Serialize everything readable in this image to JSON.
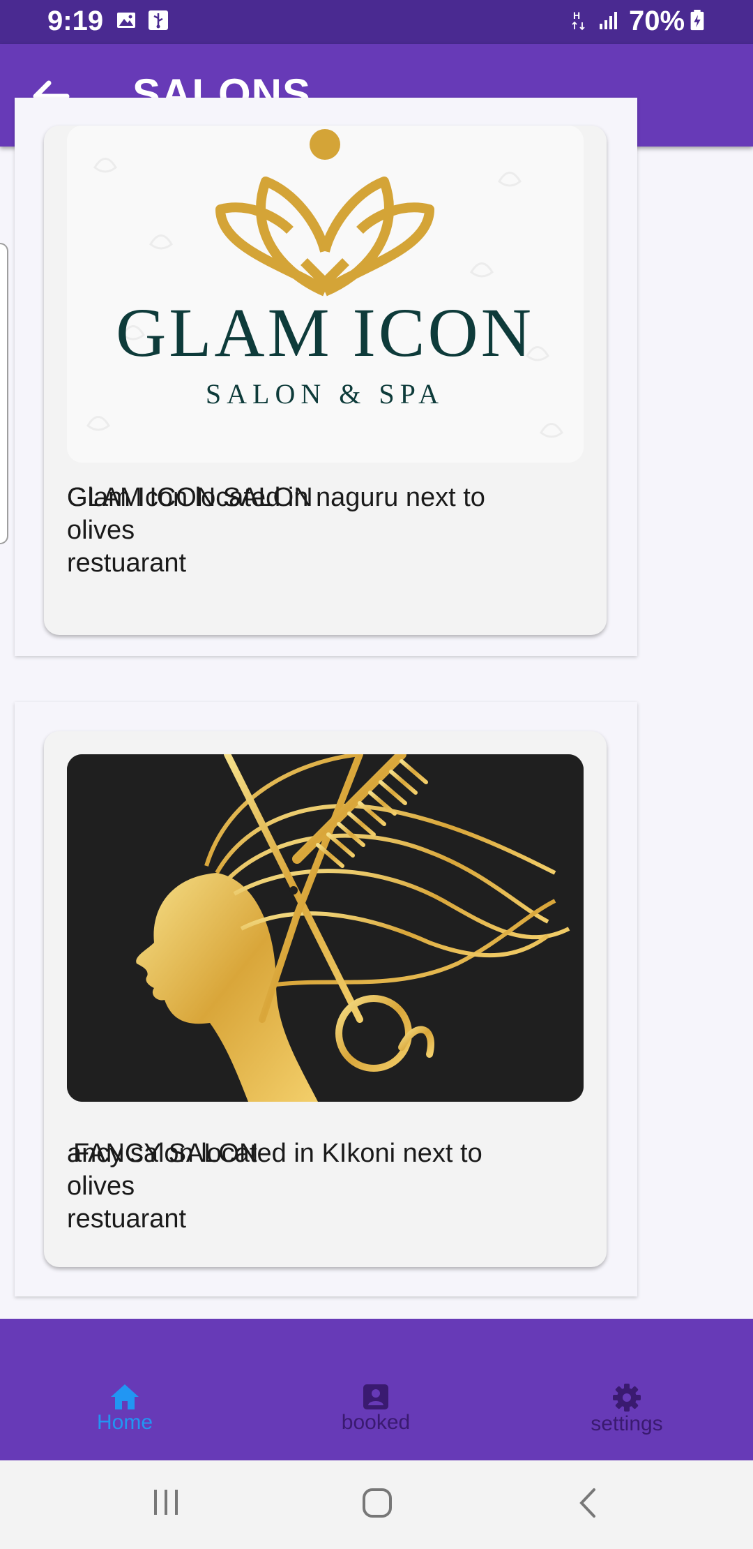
{
  "status_bar": {
    "time": "9:19",
    "battery": "70%",
    "icons": [
      "image-icon",
      "usb-icon",
      "hplus-signal-icon",
      "cell-signal-icon",
      "battery-charging-icon"
    ]
  },
  "app_bar": {
    "title": "SALONS",
    "back_icon": "arrow-back-icon"
  },
  "salons": [
    {
      "logo_title": "GLAM ICON",
      "logo_subtitle": "SALON & SPA",
      "name": "GLAM ICON SALON",
      "description_lines": [
        "Glam Icon located in naguru next to",
        "olives",
        "restuarant"
      ]
    },
    {
      "name": "FANCY SALON",
      "description_lines": [
        "ancy salon located in KIkoni next to",
        "olives",
        "restuarant"
      ]
    }
  ],
  "bottom_nav": {
    "items": [
      {
        "label": "Home",
        "icon": "home-icon",
        "active": true
      },
      {
        "label": "booked",
        "icon": "account-box-icon",
        "active": false
      },
      {
        "label": "settings",
        "icon": "gear-icon",
        "active": false
      }
    ],
    "active_color": "#2196f3",
    "inactive_color": "#3a1a70"
  },
  "colors": {
    "status_bar": "#4a2a91",
    "primary": "#673ab7",
    "logo_gold": "#d4a437",
    "logo_teal": "#0e3b3a"
  }
}
